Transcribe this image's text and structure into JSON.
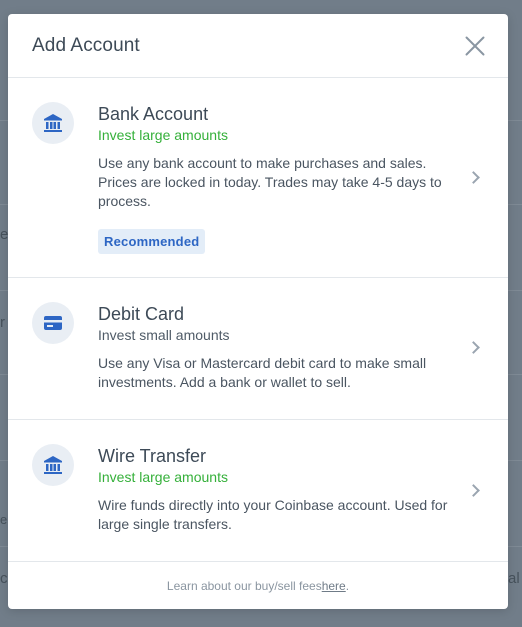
{
  "modal": {
    "title": "Add Account",
    "close_icon": "close-icon"
  },
  "options": [
    {
      "icon": "bank-icon",
      "title": "Bank Account",
      "subtitle": "Invest large amounts",
      "description": "Use any bank account to make purchases and sales. Prices are locked in today. Trades may take 4-5 days to process.",
      "badge": "Recommended"
    },
    {
      "icon": "card-icon",
      "title": "Debit Card",
      "subtitle": "Invest small amounts",
      "description": "Use any Visa or Mastercard debit card to make small investments. Add a bank or wallet to sell."
    },
    {
      "icon": "bank-icon",
      "title": "Wire Transfer",
      "subtitle": "Invest large amounts",
      "description": "Wire funds directly into your Coinbase account. Used for large single transfers."
    }
  ],
  "footer": {
    "text": "Learn about our buy/sell fees ",
    "link": "here",
    "suffix": "."
  },
  "background": {
    "fragments": [
      "e",
      "r",
      "e",
      "co",
      "al"
    ]
  },
  "colors": {
    "accent_blue": "#2d66c4",
    "green": "#35b03a",
    "icon_bg": "#e9eef4",
    "badge_bg": "#e3edf8"
  }
}
